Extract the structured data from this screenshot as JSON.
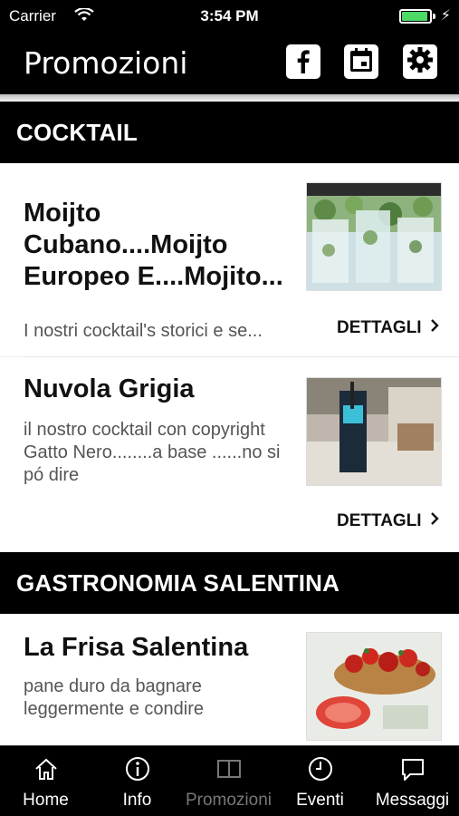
{
  "status_bar": {
    "carrier": "Carrier",
    "time": "3:54 PM"
  },
  "nav": {
    "title": "Promozioni"
  },
  "sections": [
    {
      "header": "COCKTAIL",
      "items": [
        {
          "title": "Moijto Cubano....Moijto Europeo E....Mojito...",
          "description": "I nostri cocktail's storici  e se...",
          "details_label": "DETTAGLI"
        },
        {
          "title": "Nuvola Grigia",
          "description": "il nostro cocktail con copyright Gatto Nero........a base ......no si pó dire",
          "details_label": "DETTAGLI"
        }
      ]
    },
    {
      "header": "GASTRONOMIA SALENTINA",
      "items": [
        {
          "title": "La Frisa Salentina",
          "description": "pane duro da bagnare leggermente e condire"
        }
      ]
    }
  ],
  "tabs": [
    {
      "label": "Home",
      "icon": "home-icon"
    },
    {
      "label": "Info",
      "icon": "info-icon"
    },
    {
      "label": "Promozioni",
      "icon": "book-icon",
      "active": true
    },
    {
      "label": "Eventi",
      "icon": "clock-icon"
    },
    {
      "label": "Messaggi",
      "icon": "message-icon"
    }
  ],
  "colors": {
    "bar": "#000000",
    "battery": "#4cd964",
    "active_tab": "#777777"
  }
}
